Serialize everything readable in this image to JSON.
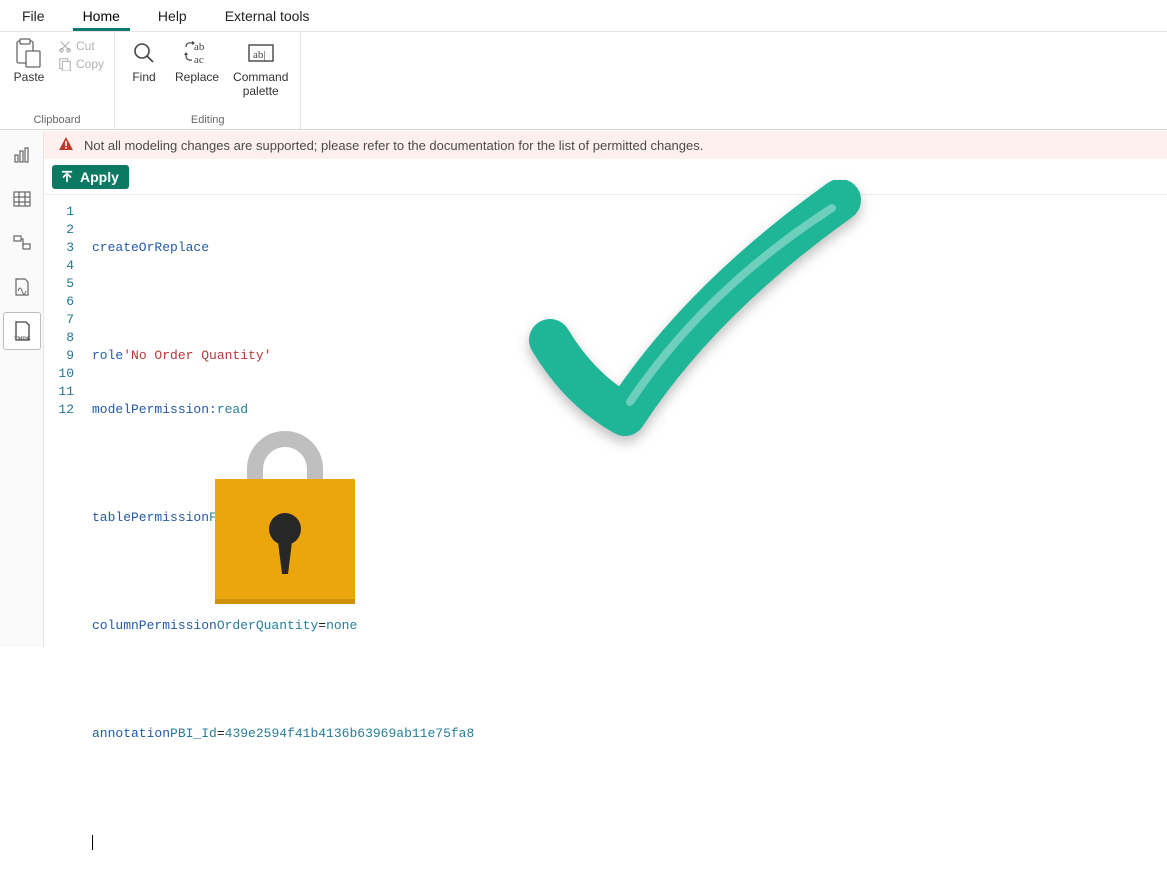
{
  "menu": {
    "file": "File",
    "home": "Home",
    "help": "Help",
    "external": "External tools"
  },
  "ribbon": {
    "clipboard": {
      "paste": "Paste",
      "cut": "Cut",
      "copy": "Copy",
      "group": "Clipboard"
    },
    "editing": {
      "find": "Find",
      "replace": "Replace",
      "palette1": "Command",
      "palette2": "palette",
      "group": "Editing"
    }
  },
  "warning": "Not all modeling changes are supported; please refer to the documentation for the list of permitted changes.",
  "apply": "Apply",
  "leftbar": {
    "tmdl": "TMDL"
  },
  "code": {
    "l1_kw": "createOrReplace",
    "l3_kw": "role",
    "l3_str": "'No Order Quantity'",
    "l4_kw": "modelPermission:",
    "l4_val": "read",
    "l6_kw": "tablePermission",
    "l6_id": "FactInternetSales",
    "l8_kw": "columnPermission",
    "l8_id": "OrderQuantity",
    "l8_eq": "=",
    "l8_val": "none",
    "l10_kw": "annotation",
    "l10_id": "PBI_Id",
    "l10_eq": "=",
    "l10_val": "439e2594f41b4136b63969ab11e75fa8",
    "lines": [
      "1",
      "2",
      "3",
      "4",
      "5",
      "6",
      "7",
      "8",
      "9",
      "10",
      "11",
      "12"
    ]
  }
}
